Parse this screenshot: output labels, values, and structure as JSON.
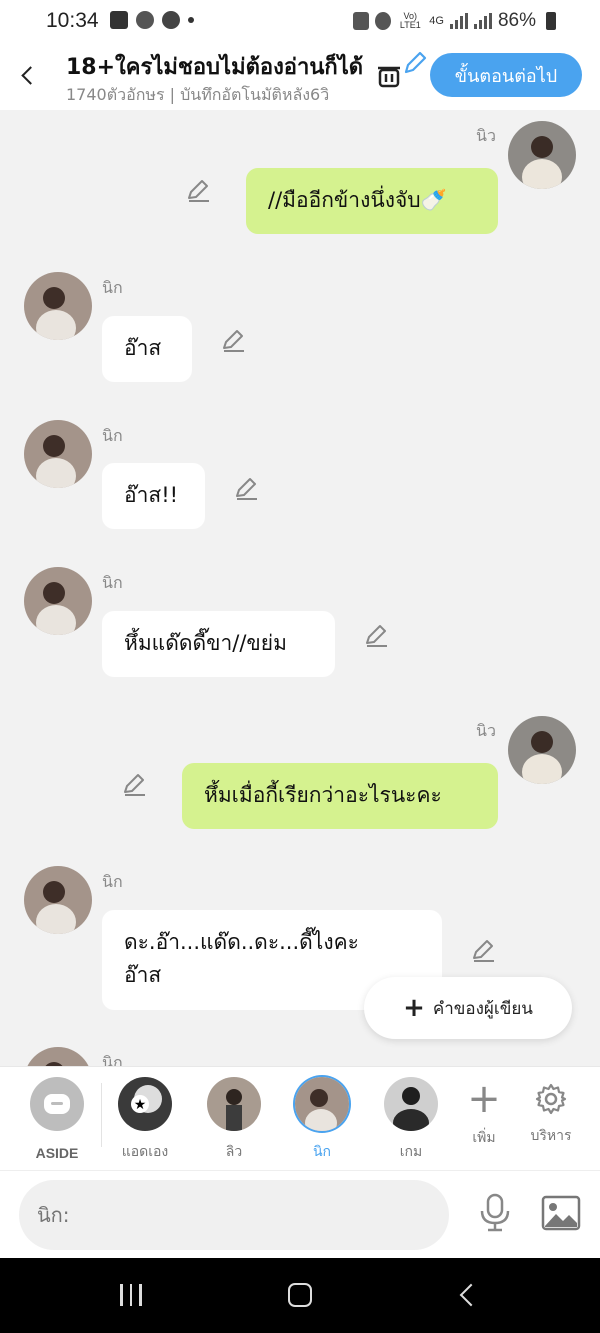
{
  "status_bar": {
    "time": "10:34",
    "battery": "86%",
    "network_lte": "Vo) LTE1",
    "network_4g": "4G"
  },
  "header": {
    "title": "18+ใครไม่ชอบไม่ต้องอ่านก็ได้",
    "subtitle": "1740ตัวอักษร | บันทึกอัตโนมัติหลัง6วิ",
    "next_label": "ขั้นตอนต่อไป"
  },
  "messages": [
    {
      "speaker": "นิว",
      "side": "right",
      "text": "//มืออีกข้างนึ่งจับ🍼"
    },
    {
      "speaker": "นิก",
      "side": "left",
      "text": "อ๊าส"
    },
    {
      "speaker": "นิก",
      "side": "left",
      "text": "อ๊าส!!"
    },
    {
      "speaker": "นิก",
      "side": "left",
      "text": "หึ้มแด๊ดดี๊ขา//ขย่ม"
    },
    {
      "speaker": "นิว",
      "side": "right",
      "text": "หึ้มเมื่อกี้เรียกว่าอะไรนะคะ"
    },
    {
      "speaker": "นิก",
      "side": "left",
      "text_line1": "ดะ.อ๊า...แด๊ด..ดะ...ดี๊ไงคะ",
      "text_line2": "อ๊าส"
    },
    {
      "speaker": "นิก",
      "side": "left",
      "text": ""
    }
  ],
  "float_button": {
    "label": "คำของผู้เขียน",
    "icon": "plus-icon"
  },
  "character_bar": {
    "aside_label": "ASIDE",
    "characters": [
      {
        "label": "แอดเอง"
      },
      {
        "label": "ลิว"
      },
      {
        "label": "นิก"
      },
      {
        "label": "เกม"
      }
    ],
    "add_label": "เพิ่ม",
    "manage_label": "บริหาร"
  },
  "input": {
    "placeholder": "นิก:"
  },
  "colors": {
    "accent": "#4aa3ef",
    "right_bubble": "#d5f28f",
    "left_bubble": "#ffffff",
    "background": "#f2f2f2"
  }
}
